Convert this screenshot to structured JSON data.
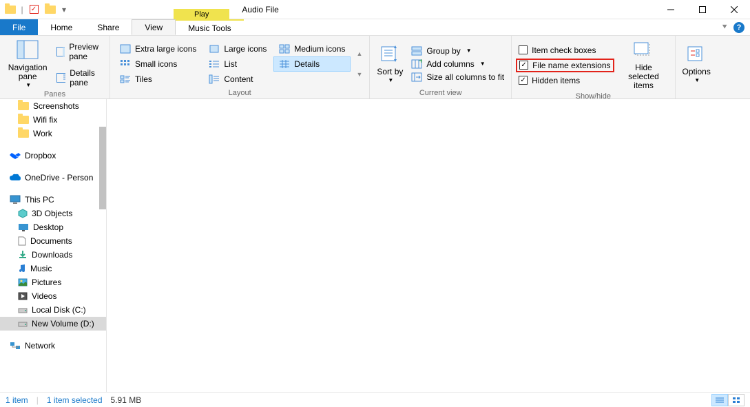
{
  "titlebar": {
    "context_label": "Play",
    "title": "Audio File"
  },
  "menu": {
    "file": "File",
    "home": "Home",
    "share": "Share",
    "view": "View",
    "music_tools": "Music Tools"
  },
  "ribbon": {
    "panes": {
      "nav": "Navigation pane",
      "preview": "Preview pane",
      "details": "Details pane",
      "group": "Panes"
    },
    "layout": {
      "xl": "Extra large icons",
      "l": "Large icons",
      "m": "Medium icons",
      "s": "Small icons",
      "list": "List",
      "details": "Details",
      "tiles": "Tiles",
      "content": "Content",
      "group": "Layout"
    },
    "current": {
      "sort": "Sort by",
      "groupby": "Group by",
      "addcols": "Add columns",
      "sizecols": "Size all columns to fit",
      "group": "Current view"
    },
    "showhide": {
      "checkboxes": "Item check boxes",
      "ext": "File name extensions",
      "hidden": "Hidden items",
      "hidesel": "Hide selected items",
      "group": "Show/hide"
    },
    "options": "Options"
  },
  "tree": {
    "screenshots": "Screenshots",
    "wifi": "Wifi fix",
    "work": "Work",
    "dropbox": "Dropbox",
    "onedrive": "OneDrive - Person",
    "thispc": "This PC",
    "objects3d": "3D Objects",
    "desktop": "Desktop",
    "documents": "Documents",
    "downloads": "Downloads",
    "music": "Music",
    "pictures": "Pictures",
    "videos": "Videos",
    "cdrive": "Local Disk (C:)",
    "ddrive": "New Volume (D:)",
    "network": "Network"
  },
  "status": {
    "count": "1 item",
    "selected": "1 item selected",
    "size": "5.91 MB"
  }
}
